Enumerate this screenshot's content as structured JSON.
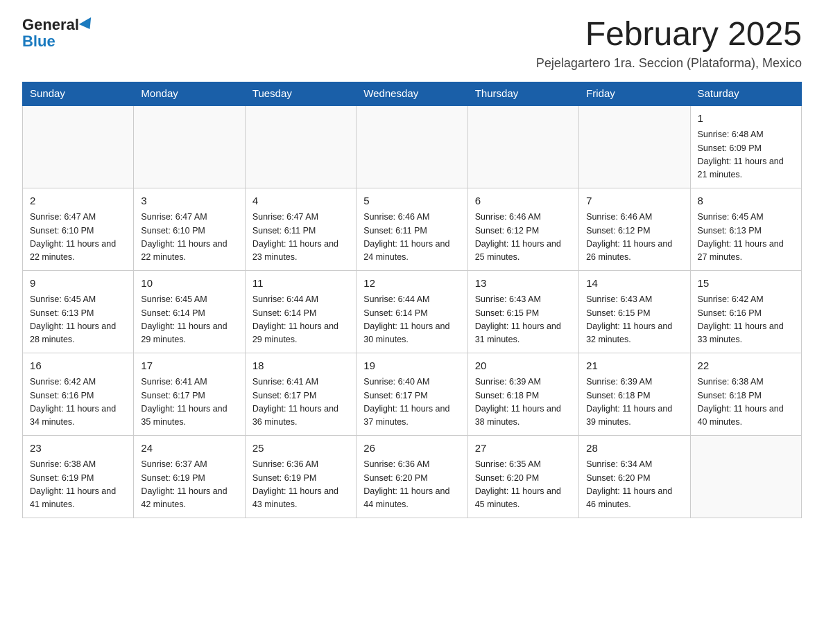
{
  "logo": {
    "general": "General",
    "blue": "Blue"
  },
  "title": "February 2025",
  "subtitle": "Pejelagartero 1ra. Seccion (Plataforma), Mexico",
  "days_header": [
    "Sunday",
    "Monday",
    "Tuesday",
    "Wednesday",
    "Thursday",
    "Friday",
    "Saturday"
  ],
  "weeks": [
    [
      {
        "day": "",
        "sunrise": "",
        "sunset": "",
        "daylight": ""
      },
      {
        "day": "",
        "sunrise": "",
        "sunset": "",
        "daylight": ""
      },
      {
        "day": "",
        "sunrise": "",
        "sunset": "",
        "daylight": ""
      },
      {
        "day": "",
        "sunrise": "",
        "sunset": "",
        "daylight": ""
      },
      {
        "day": "",
        "sunrise": "",
        "sunset": "",
        "daylight": ""
      },
      {
        "day": "",
        "sunrise": "",
        "sunset": "",
        "daylight": ""
      },
      {
        "day": "1",
        "sunrise": "Sunrise: 6:48 AM",
        "sunset": "Sunset: 6:09 PM",
        "daylight": "Daylight: 11 hours and 21 minutes."
      }
    ],
    [
      {
        "day": "2",
        "sunrise": "Sunrise: 6:47 AM",
        "sunset": "Sunset: 6:10 PM",
        "daylight": "Daylight: 11 hours and 22 minutes."
      },
      {
        "day": "3",
        "sunrise": "Sunrise: 6:47 AM",
        "sunset": "Sunset: 6:10 PM",
        "daylight": "Daylight: 11 hours and 22 minutes."
      },
      {
        "day": "4",
        "sunrise": "Sunrise: 6:47 AM",
        "sunset": "Sunset: 6:11 PM",
        "daylight": "Daylight: 11 hours and 23 minutes."
      },
      {
        "day": "5",
        "sunrise": "Sunrise: 6:46 AM",
        "sunset": "Sunset: 6:11 PM",
        "daylight": "Daylight: 11 hours and 24 minutes."
      },
      {
        "day": "6",
        "sunrise": "Sunrise: 6:46 AM",
        "sunset": "Sunset: 6:12 PM",
        "daylight": "Daylight: 11 hours and 25 minutes."
      },
      {
        "day": "7",
        "sunrise": "Sunrise: 6:46 AM",
        "sunset": "Sunset: 6:12 PM",
        "daylight": "Daylight: 11 hours and 26 minutes."
      },
      {
        "day": "8",
        "sunrise": "Sunrise: 6:45 AM",
        "sunset": "Sunset: 6:13 PM",
        "daylight": "Daylight: 11 hours and 27 minutes."
      }
    ],
    [
      {
        "day": "9",
        "sunrise": "Sunrise: 6:45 AM",
        "sunset": "Sunset: 6:13 PM",
        "daylight": "Daylight: 11 hours and 28 minutes."
      },
      {
        "day": "10",
        "sunrise": "Sunrise: 6:45 AM",
        "sunset": "Sunset: 6:14 PM",
        "daylight": "Daylight: 11 hours and 29 minutes."
      },
      {
        "day": "11",
        "sunrise": "Sunrise: 6:44 AM",
        "sunset": "Sunset: 6:14 PM",
        "daylight": "Daylight: 11 hours and 29 minutes."
      },
      {
        "day": "12",
        "sunrise": "Sunrise: 6:44 AM",
        "sunset": "Sunset: 6:14 PM",
        "daylight": "Daylight: 11 hours and 30 minutes."
      },
      {
        "day": "13",
        "sunrise": "Sunrise: 6:43 AM",
        "sunset": "Sunset: 6:15 PM",
        "daylight": "Daylight: 11 hours and 31 minutes."
      },
      {
        "day": "14",
        "sunrise": "Sunrise: 6:43 AM",
        "sunset": "Sunset: 6:15 PM",
        "daylight": "Daylight: 11 hours and 32 minutes."
      },
      {
        "day": "15",
        "sunrise": "Sunrise: 6:42 AM",
        "sunset": "Sunset: 6:16 PM",
        "daylight": "Daylight: 11 hours and 33 minutes."
      }
    ],
    [
      {
        "day": "16",
        "sunrise": "Sunrise: 6:42 AM",
        "sunset": "Sunset: 6:16 PM",
        "daylight": "Daylight: 11 hours and 34 minutes."
      },
      {
        "day": "17",
        "sunrise": "Sunrise: 6:41 AM",
        "sunset": "Sunset: 6:17 PM",
        "daylight": "Daylight: 11 hours and 35 minutes."
      },
      {
        "day": "18",
        "sunrise": "Sunrise: 6:41 AM",
        "sunset": "Sunset: 6:17 PM",
        "daylight": "Daylight: 11 hours and 36 minutes."
      },
      {
        "day": "19",
        "sunrise": "Sunrise: 6:40 AM",
        "sunset": "Sunset: 6:17 PM",
        "daylight": "Daylight: 11 hours and 37 minutes."
      },
      {
        "day": "20",
        "sunrise": "Sunrise: 6:39 AM",
        "sunset": "Sunset: 6:18 PM",
        "daylight": "Daylight: 11 hours and 38 minutes."
      },
      {
        "day": "21",
        "sunrise": "Sunrise: 6:39 AM",
        "sunset": "Sunset: 6:18 PM",
        "daylight": "Daylight: 11 hours and 39 minutes."
      },
      {
        "day": "22",
        "sunrise": "Sunrise: 6:38 AM",
        "sunset": "Sunset: 6:18 PM",
        "daylight": "Daylight: 11 hours and 40 minutes."
      }
    ],
    [
      {
        "day": "23",
        "sunrise": "Sunrise: 6:38 AM",
        "sunset": "Sunset: 6:19 PM",
        "daylight": "Daylight: 11 hours and 41 minutes."
      },
      {
        "day": "24",
        "sunrise": "Sunrise: 6:37 AM",
        "sunset": "Sunset: 6:19 PM",
        "daylight": "Daylight: 11 hours and 42 minutes."
      },
      {
        "day": "25",
        "sunrise": "Sunrise: 6:36 AM",
        "sunset": "Sunset: 6:19 PM",
        "daylight": "Daylight: 11 hours and 43 minutes."
      },
      {
        "day": "26",
        "sunrise": "Sunrise: 6:36 AM",
        "sunset": "Sunset: 6:20 PM",
        "daylight": "Daylight: 11 hours and 44 minutes."
      },
      {
        "day": "27",
        "sunrise": "Sunrise: 6:35 AM",
        "sunset": "Sunset: 6:20 PM",
        "daylight": "Daylight: 11 hours and 45 minutes."
      },
      {
        "day": "28",
        "sunrise": "Sunrise: 6:34 AM",
        "sunset": "Sunset: 6:20 PM",
        "daylight": "Daylight: 11 hours and 46 minutes."
      },
      {
        "day": "",
        "sunrise": "",
        "sunset": "",
        "daylight": ""
      }
    ]
  ]
}
